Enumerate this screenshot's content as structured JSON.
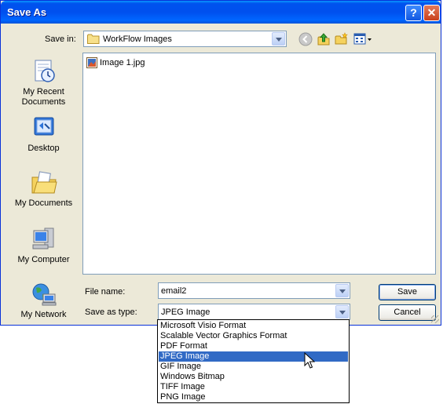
{
  "window": {
    "title": "Save As"
  },
  "titlebar": {
    "help_label": "?",
    "close_label": "✕"
  },
  "toolbar": {
    "save_in_label": "Save in:",
    "save_in_value": "WorkFlow Images",
    "icons": [
      "back-icon",
      "up-folder-icon",
      "new-folder-icon",
      "views-menu-icon"
    ]
  },
  "places": [
    {
      "label": "My Recent Documents",
      "icon": "recent-documents-icon"
    },
    {
      "label": "Desktop",
      "icon": "desktop-icon"
    },
    {
      "label": "My Documents",
      "icon": "my-documents-icon"
    },
    {
      "label": "My Computer",
      "icon": "my-computer-icon"
    },
    {
      "label": "My Network",
      "icon": "my-network-icon"
    }
  ],
  "files": [
    {
      "name": "Image  1.jpg",
      "icon": "jpg-file-icon"
    }
  ],
  "form": {
    "file_name_label": "File name:",
    "file_name_value": "email2",
    "save_as_type_label": "Save as type:",
    "save_as_type_value": "JPEG Image"
  },
  "buttons": {
    "save": "Save",
    "cancel": "Cancel"
  },
  "type_options": [
    "Microsoft Visio Format",
    "Scalable Vector Graphics Format",
    "PDF Format",
    "JPEG Image",
    "GIF Image",
    "Windows Bitmap",
    "TIFF Image",
    "PNG Image"
  ],
  "selected_type": "JPEG Image",
  "colors": {
    "titlebar": "#0053ee",
    "selection": "#316ac5",
    "dialog_bg": "#ece9d8"
  }
}
